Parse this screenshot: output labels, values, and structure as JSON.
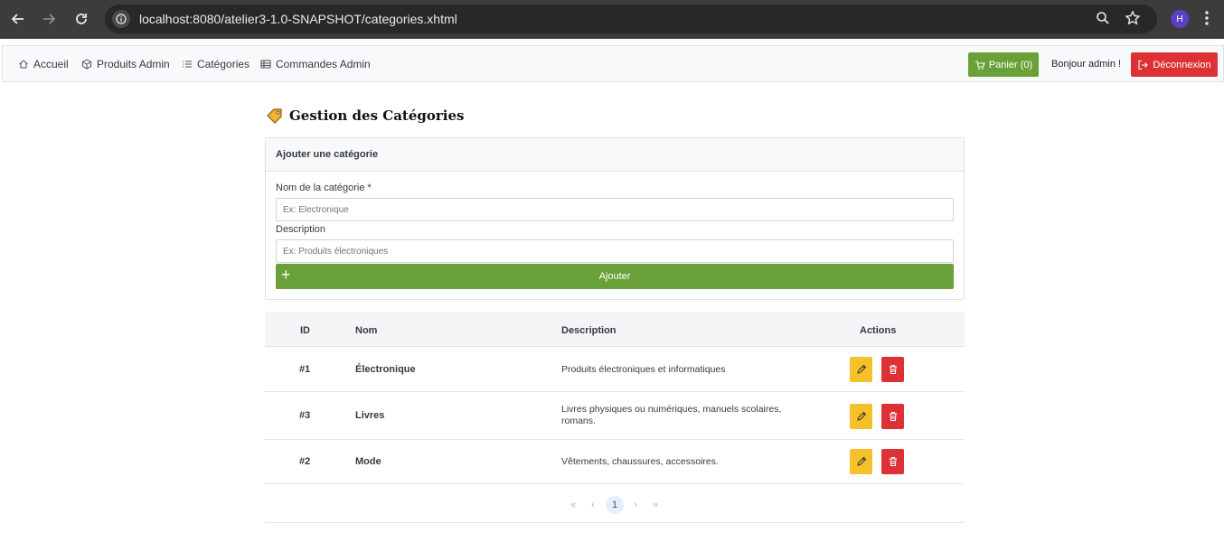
{
  "browser": {
    "url_host": "localhost",
    "url_rest": ":8080/atelier3-1.0-SNAPSHOT/categories.xhtml",
    "profile_initial": "H"
  },
  "navbar": {
    "items": [
      {
        "label": "Accueil",
        "icon": "home-icon"
      },
      {
        "label": "Produits Admin",
        "icon": "box-icon"
      },
      {
        "label": "Catégories",
        "icon": "list-icon"
      },
      {
        "label": "Commandes Admin",
        "icon": "table-icon"
      }
    ],
    "cart_label": "Panier (0)",
    "greeting": "Bonjour admin !",
    "logout_label": "Déconnexion"
  },
  "page": {
    "title": "Gestion des Catégories",
    "title_icon": "tag-icon"
  },
  "form": {
    "header": "Ajouter une catégorie",
    "name_label": "Nom de la catégorie *",
    "name_placeholder": "Ex: Électronique",
    "desc_label": "Description",
    "desc_placeholder": "Ex: Produits électroniques",
    "add_label": "Ajouter"
  },
  "table": {
    "columns": [
      "ID",
      "Nom",
      "Description",
      "Actions"
    ],
    "rows": [
      {
        "id": "#1",
        "name": "Électronique",
        "desc": "Produits électroniques et informatiques"
      },
      {
        "id": "#3",
        "name": "Livres",
        "desc": "Livres physiques ou numériques, manuels scolaires, romans."
      },
      {
        "id": "#2",
        "name": "Mode",
        "desc": "Vêtements, chaussures, accessoires."
      }
    ]
  },
  "pagination": {
    "first": "«",
    "prev": "‹",
    "current": "1",
    "next": "›",
    "last": "»"
  },
  "colors": {
    "success": "#6aa038",
    "danger": "#dc3235",
    "warning": "#f6c02a"
  }
}
